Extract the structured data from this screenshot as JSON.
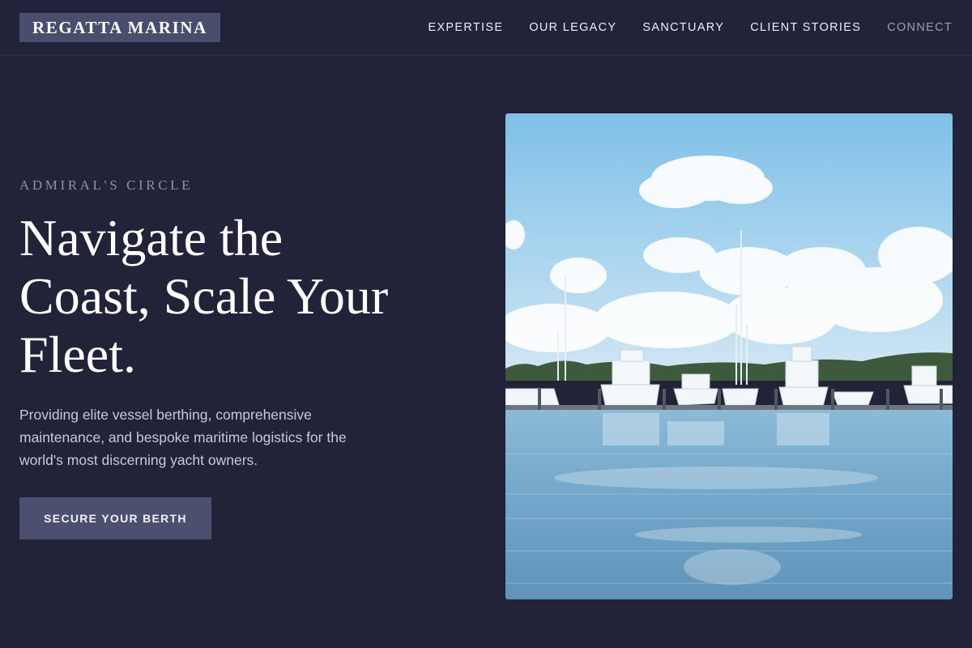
{
  "header": {
    "logo": "REGATTA MARINA",
    "nav": [
      {
        "label": "EXPERTISE"
      },
      {
        "label": "OUR LEGACY"
      },
      {
        "label": "SANCTUARY"
      },
      {
        "label": "CLIENT STORIES"
      },
      {
        "label": "CONNECT"
      }
    ]
  },
  "hero": {
    "eyebrow": "ADMIRAL'S CIRCLE",
    "headline_lines": [
      "Navigate the",
      "Coast, Scale Your",
      "Fleet."
    ],
    "subtext_lines": [
      "Providing elite vessel berthing, comprehensive",
      "maintenance, and bespoke maritime logistics for the",
      "world's most discerning yacht owners."
    ],
    "cta_label": "SECURE YOUR BERTH",
    "image": {
      "subject": "marina photo with white yachts docked under a blue sky with clouds",
      "colors": {
        "sky_top": "#7fc0e8",
        "sky_bottom": "#cfe6f4",
        "water_top": "#7fb0d0",
        "water_bottom": "#5f93b8"
      }
    }
  }
}
